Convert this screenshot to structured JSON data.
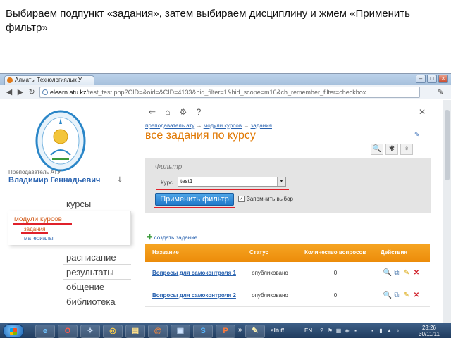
{
  "slide": {
    "caption": "Выбираем подпункт «задания», затем выбираем дисциплину и жмем «Применить фильтр»"
  },
  "browser": {
    "tab_title": "Алматы Технологиялык У",
    "url_host": "elearn.atu.kz",
    "url_path": "/test_test.php?CID=&oid=&CID=4133&hid_filter=1&hid_scope=m16&ch_remember_filter=checkbox"
  },
  "sidebar": {
    "teacher_role": "Преподаватель АТУ",
    "teacher_name": "Владимир Геннадьевич",
    "menu_courses": "курсы",
    "submenu_heading": "модули курсов",
    "submenu_items": [
      "задания",
      "материалы"
    ],
    "menu_items": [
      "расписание",
      "результаты",
      "общение",
      "библиотека"
    ]
  },
  "main": {
    "breadcrumb": {
      "part1": "преподаватель ату",
      "arrow": "→",
      "part2": "модули курсов",
      "part3": "задания"
    },
    "page_title": "все задания по курсу",
    "filter": {
      "title": "Фильтр",
      "course_label": "Курс",
      "course_value": "test1",
      "apply_label": "Применить фильтр",
      "remember_label": "Запомнить выбор",
      "remember_checked": true
    },
    "create_link": "создать задание",
    "table": {
      "headers": [
        "Название",
        "Статус",
        "Количество вопросов",
        "Действия"
      ],
      "rows": [
        {
          "name": "Вопросы для самоконтроля 1",
          "status": "опубликовано",
          "count": "0"
        },
        {
          "name": "Вопросы для самоконтроля 2",
          "status": "опубликовано",
          "count": "0"
        }
      ]
    }
  },
  "taskbar": {
    "task_label": "alltuff",
    "overflow": "»",
    "lang": "EN",
    "time": "23:26",
    "date": "30/11/11"
  },
  "colors": {
    "accent_orange": "#e07700",
    "link_blue": "#2a63b0",
    "highlight_red": "#e0202a",
    "table_header": "#f6a623"
  }
}
